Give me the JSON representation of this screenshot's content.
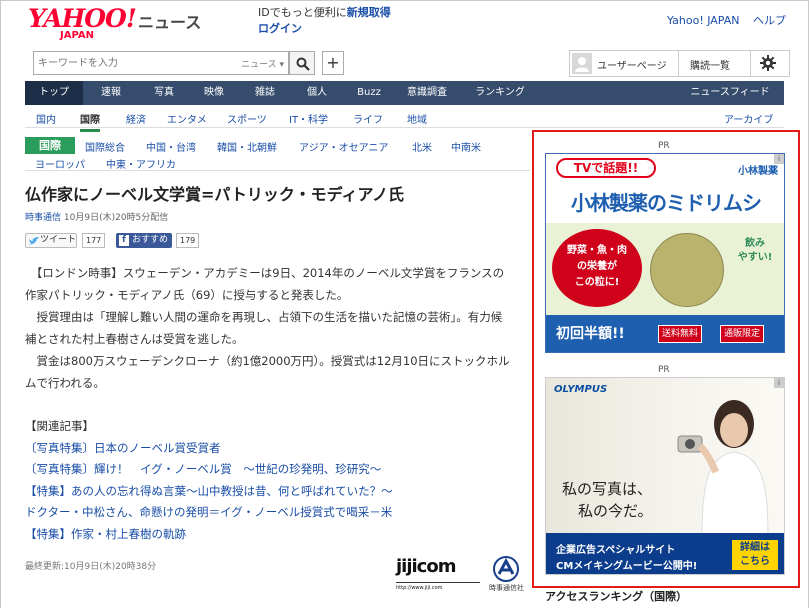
{
  "header": {
    "logo_main": "YAHOO!",
    "logo_sub": "JAPAN",
    "logo_news": "ニュース",
    "id_text": "IDでもっと便利に",
    "id_register": "新規取得",
    "id_login": "ログイン",
    "top_links": [
      "Yahoo! JAPAN",
      "ヘルプ"
    ]
  },
  "search": {
    "placeholder": "キーワードを入力",
    "scope": "ニュース ▾",
    "plus": "+"
  },
  "user": {
    "user_page": "ユーザーページ",
    "subscribe": "購読一覧"
  },
  "nav": {
    "items": [
      "トップ",
      "速報",
      "写真",
      "映像",
      "雑誌",
      "個人",
      "Buzz",
      "意識調査",
      "ランキング"
    ],
    "newsfeed": "ニュースフィード"
  },
  "subnav": {
    "items": [
      "国内",
      "国際",
      "経済",
      "エンタメ",
      "スポーツ",
      "IT・科学",
      "ライフ",
      "地域"
    ],
    "archive": "アーカイブ"
  },
  "category": {
    "badge": "国際",
    "row1": [
      "国際総合",
      "中国・台湾",
      "韓国・北朝鮮",
      "アジア・オセアニア",
      "北米",
      "中南米"
    ],
    "row2": [
      "ヨーロッパ",
      "中東・アフリカ"
    ]
  },
  "article": {
    "title": "仏作家にノーベル文学賞=パトリック・モディアノ氏",
    "source": "時事通信",
    "date": "10月9日(木)20時5分配信",
    "tweet_label": "ツイート",
    "tweet_count": "177",
    "fb_label": "おすすめ",
    "fb_count": "179",
    "body": [
      "【ロンドン時事】スウェーデン・アカデミーは9日、2014年のノーベル文学賞をフランスの",
      "作家パトリック・モディアノ氏（69）に授与すると発表した。",
      "授賞理由は「理解し難い人間の運命を再現し、占領下の生活を描いた記憶の芸術」。有力候",
      "補とされた村上春樹さんは受賞を逃した。",
      "賞金は800万スウェーデンクローナ（約1億2000万円）。授賞式は12月10日にストックホル",
      "ムで行われる。"
    ],
    "related_header": "【関連記事】",
    "related": [
      "〔写真特集〕日本のノーベル賞受賞者",
      "〔写真特集〕輝け！　イグ・ノーベル賞　～世紀の珍発明、珍研究～",
      "【特集】あの人の忘れ得ぬ言葉～山中教授は昔、何と呼ばれていた？～",
      "ドクター・中松さん、命懸けの発明＝イグ・ノーベル授賞式で喝采－米",
      "【特集】作家・村上春樹の軌跡"
    ],
    "updated": "最終更新:10月9日(木)20時38分",
    "jiji_logo": "jijicom",
    "jiji_url": "http://www.jiji.com",
    "jiji_name": "時事通信社"
  },
  "ads": {
    "pr": "PR",
    "ad1": {
      "tv": "TVで話題!!",
      "brand": "小林製薬",
      "title": "小林製薬のミドリムシ",
      "oval": "野菜・魚・肉\nの栄養が\nこの粒に!",
      "eat": "飲み\nやすい!",
      "half": "初回半額!!",
      "tag1": "送料無料",
      "tag2": "通販限定"
    },
    "ad2": {
      "brand": "OLYMPUS",
      "caption1": "私の写真は、",
      "caption2": "私の今だ。",
      "line1": "企業広告スペシャルサイト",
      "line2": "CMメイキングムービー公開中!",
      "cta": "詳細は\nこちら"
    },
    "info": "i"
  },
  "sidebar": {
    "access_ranking": "アクセスランキング（国際）"
  }
}
